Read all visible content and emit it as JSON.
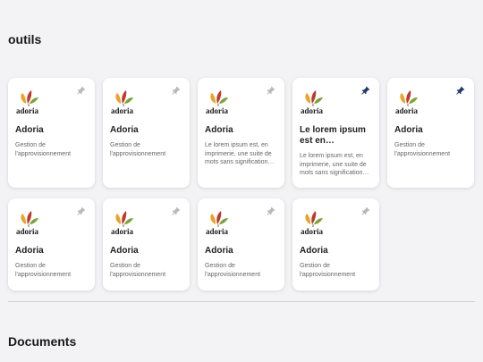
{
  "sections": {
    "outils": "outils",
    "documents": "Documents"
  },
  "cards": [
    {
      "logo_text": "adoria",
      "title": "Adoria",
      "description": "Gestion de l'approvisionnement",
      "pinned": false
    },
    {
      "logo_text": "adoria",
      "title": "Adoria",
      "description": "Gestion de l'approvisionnement",
      "pinned": false
    },
    {
      "logo_text": "adoria",
      "title": "Adoria",
      "description": "Le lorem ipsum est, en imprimerie, une suite de mots sans signification utilisée à titre provisoire",
      "pinned": false
    },
    {
      "logo_text": "adoria",
      "title": "Le lorem ipsum est en imprimerieLe lorem ipsum",
      "description": "Le lorem ipsum est, en imprimerie, une suite de mots sans signification utilisée à titre provisoire",
      "pinned": true
    },
    {
      "logo_text": "adoria",
      "title": "Adoria",
      "description": "Gestion de l'approvisionnement",
      "pinned": true
    },
    {
      "logo_text": "adoria",
      "title": "Adoria",
      "description": "Gestion de l'approvisionnement",
      "pinned": false
    },
    {
      "logo_text": "adoria",
      "title": "Adoria",
      "description": "Gestion de l'approvisionnement",
      "pinned": false
    },
    {
      "logo_text": "adoria",
      "title": "Adoria",
      "description": "Gestion de l'approvisionnement",
      "pinned": false
    },
    {
      "logo_text": "adoria",
      "title": "Adoria",
      "description": "Gestion de l'approvisionnement",
      "pinned": false
    }
  ],
  "icons": {
    "pin": "pin-icon",
    "logo": "adoria-logo"
  },
  "colors": {
    "pin_active": "#1f3a66",
    "pin_inactive": "#b8b8bd",
    "logo_text": "#1a1a1a"
  }
}
